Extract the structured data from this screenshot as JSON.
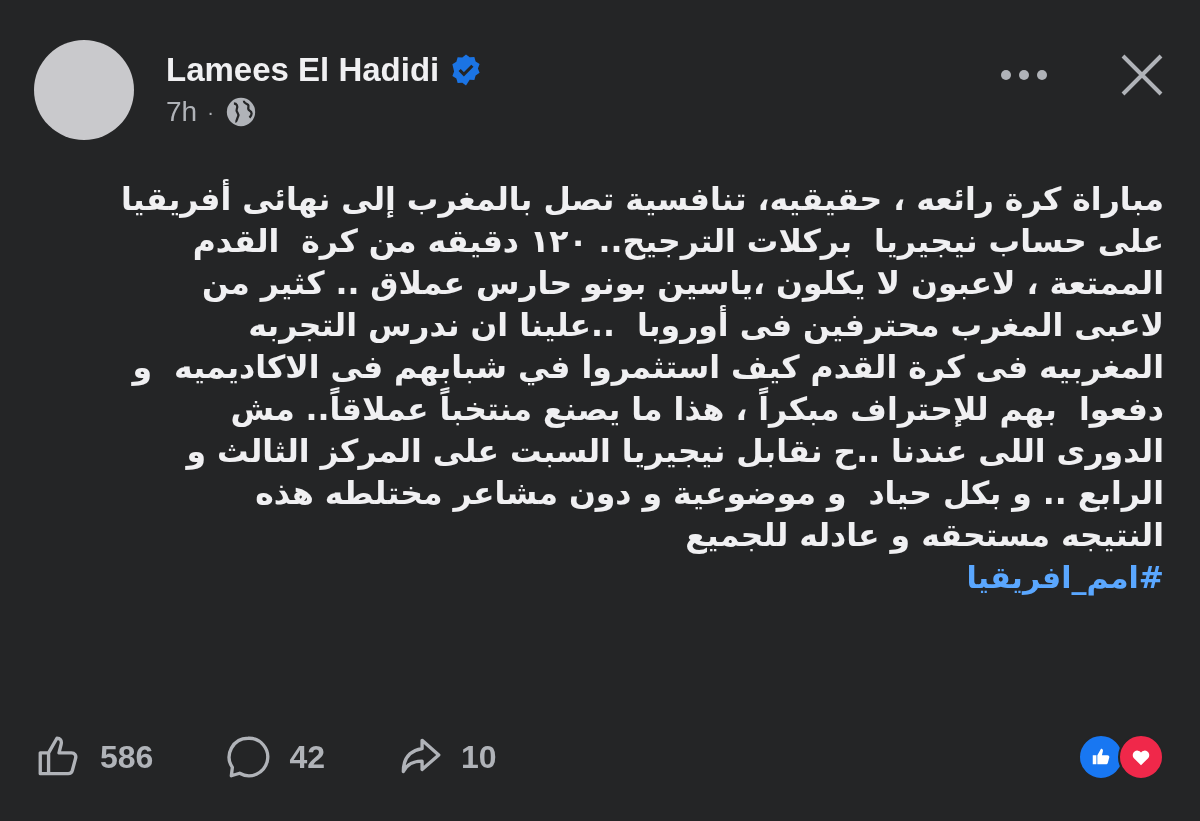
{
  "post": {
    "author": "Lamees El Hadidi",
    "verified": true,
    "time": "7h",
    "separator": "·",
    "body": "مباراة كرة رائعه ، حقيقيه، تنافسية تصل بالمغرب إلى نهائى أفريقيا\nعلى حساب نيجيريا  بركلات الترجيح.. ١٢٠ دقيقه من كرة  القدم\nالممتعة ، لاعبون لا يكلون ،ياسين بونو حارس عملاق .. كثير من\nلاعبى المغرب محترفين فى أوروبا  ..علينا ان ندرس التجربه\nالمغربيه فى كرة القدم كيف استثمروا في شبابهم فى الاكاديميه  و\nدفعوا  بهم للإحتراف مبكراً ، هذا ما يصنع منتخباً عملاقاً.. مش\nالدورى اللى عندنا ..ح نقابل نيجيريا السبت على المركز الثالث و\nالرابع .. و بكل حياد  و موضوعية و دون مشاعر مختلطه هذه\nالنتيجه مستحقه و عادله للجميع",
    "hashtag": "#امم_افريقيا"
  },
  "actions": {
    "likes": "586",
    "comments": "42",
    "shares": "10"
  },
  "reactions": [
    {
      "kind": "like",
      "color": "#1877f2"
    },
    {
      "kind": "love",
      "color": "#f0284a"
    }
  ]
}
